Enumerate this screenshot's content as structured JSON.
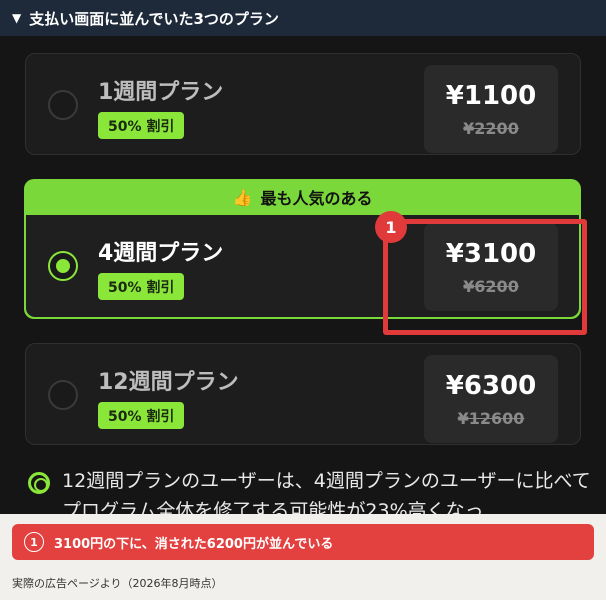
{
  "header": {
    "title": "支払い画面に並んでいた3つのプラン"
  },
  "plans": [
    {
      "name": "1週間プラン",
      "discount": "50% 割引",
      "price": "¥1100",
      "old_price": "¥2200",
      "selected": false
    },
    {
      "name": "4週間プラン",
      "discount": "50% 割引",
      "price": "¥3100",
      "old_price": "¥6200",
      "selected": true,
      "tag": "最も人気のある"
    },
    {
      "name": "12週間プラン",
      "discount": "50% 割引",
      "price": "¥6300",
      "old_price": "¥12600",
      "selected": false
    }
  ],
  "annotation": {
    "number": "1"
  },
  "info": {
    "text": "12週間プランのユーザーは、4週間プランのユーザーに比べてプログラム全体を修了する可能性が23%高くなっ"
  },
  "alert": {
    "number": "1",
    "text": "3100円の下に、消された6200円が並んでいる"
  },
  "source": "実際の広告ページより（2026年8月時点）",
  "colors": {
    "accent": "#8be63a",
    "alert": "#e34040",
    "header_bg": "#1e2a3a"
  }
}
